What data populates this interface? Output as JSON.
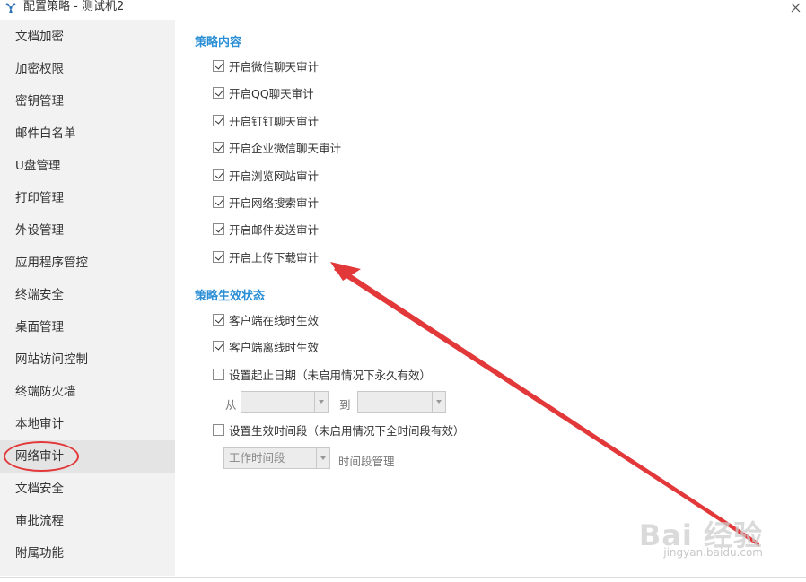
{
  "window": {
    "title": "配置策略 - 测试机2",
    "close_icon": "close-icon",
    "app_icon": "fan-icon"
  },
  "sidebar": {
    "active_index": 13,
    "items": [
      {
        "label": "文档加密"
      },
      {
        "label": "加密权限"
      },
      {
        "label": "密钥管理"
      },
      {
        "label": "邮件白名单"
      },
      {
        "label": "U盘管理"
      },
      {
        "label": "打印管理"
      },
      {
        "label": "外设管理"
      },
      {
        "label": "应用程序管控"
      },
      {
        "label": "终端安全"
      },
      {
        "label": "桌面管理"
      },
      {
        "label": "网站访问控制"
      },
      {
        "label": "终端防火墙"
      },
      {
        "label": "本地审计"
      },
      {
        "label": "网络审计"
      },
      {
        "label": "文档安全"
      },
      {
        "label": "审批流程"
      },
      {
        "label": "附属功能"
      }
    ]
  },
  "policy_content": {
    "title": "策略内容",
    "options": [
      {
        "label": "开启微信聊天审计",
        "checked": true
      },
      {
        "label": "开启QQ聊天审计",
        "checked": true
      },
      {
        "label": "开启钉钉聊天审计",
        "checked": true
      },
      {
        "label": "开启企业微信聊天审计",
        "checked": true
      },
      {
        "label": "开启浏览网站审计",
        "checked": true
      },
      {
        "label": "开启网络搜索审计",
        "checked": true
      },
      {
        "label": "开启邮件发送审计",
        "checked": true
      },
      {
        "label": "开启上传下载审计",
        "checked": true
      }
    ]
  },
  "policy_status": {
    "title": "策略生效状态",
    "online": {
      "label": "客户端在线时生效",
      "checked": true
    },
    "offline": {
      "label": "客户端离线时生效",
      "checked": true
    },
    "date_range": {
      "label": "设置起止日期（未启用情况下永久有效）",
      "checked": false,
      "from_label": "从",
      "to_label": "到",
      "from_value": "",
      "to_value": ""
    },
    "time_period": {
      "label": "设置生效时间段（未启用情况下全时间段有效）",
      "checked": false,
      "select_value": "工作时间段",
      "manage_label": "时间段管理"
    }
  },
  "watermark": {
    "brand": "Bai 经验",
    "url": "jingyan.baidu.com"
  },
  "colors": {
    "accent": "#2b8fd6",
    "annotation_red": "#e2383a",
    "sidebar_bg": "#f2f2f2"
  }
}
